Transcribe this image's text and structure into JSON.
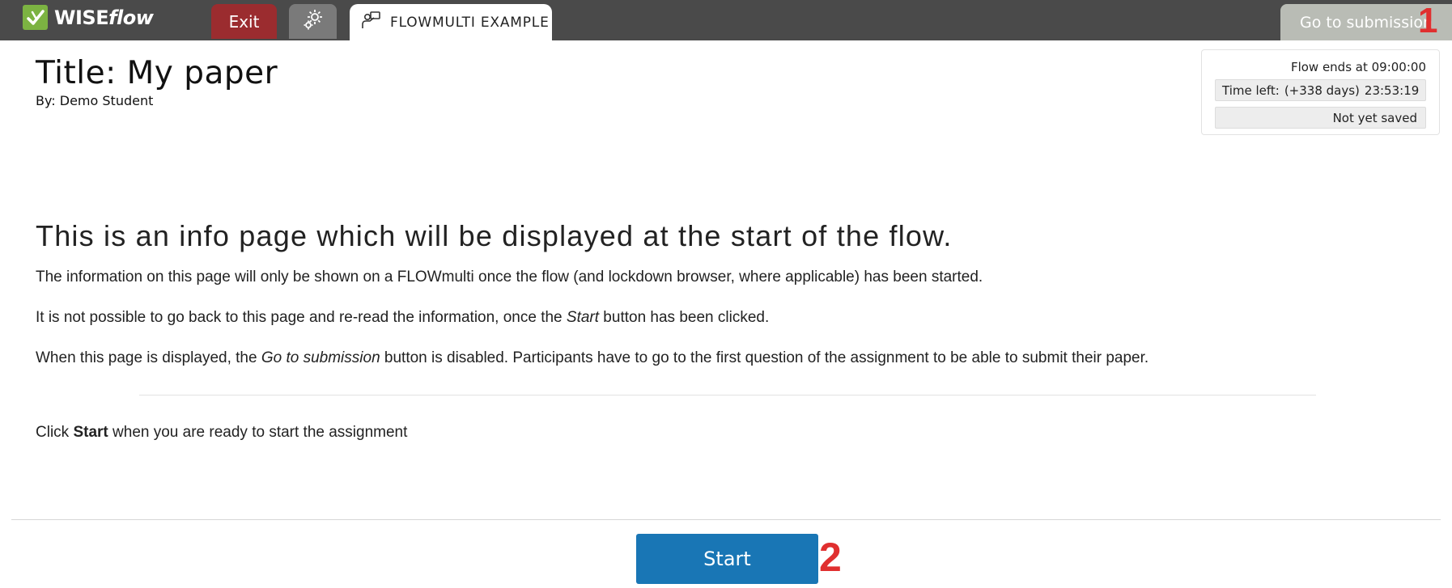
{
  "topbar": {
    "logo_text": "WISEflow",
    "logo_part_bold": "WISE",
    "logo_part_italic": "flow",
    "exit_label": "Exit",
    "settings_icon": "gear-icon",
    "tab_label": "FLOWMULTI EXAMPLE",
    "tab_icon": "presenter-icon",
    "submission_label": "Go to submission",
    "submission_marker": "1"
  },
  "header": {
    "title": "Title: My paper",
    "author": "By: Demo Student"
  },
  "status": {
    "flow_ends": "Flow ends at 09:00:00",
    "time_left_label": "Time left:",
    "time_left_days": "(+338 days)",
    "time_left_clock": "23:53:19",
    "save_state": "Not yet saved"
  },
  "info": {
    "heading": "This is an info page which will be displayed at the start of the flow.",
    "p1": "The information on this page will only be shown on a FLOWmulti once the flow (and lockdown browser, where applicable) has been started.",
    "p2_before": "It is not possible to go back to this page and re-read the information, once the ",
    "p2_em": "Start",
    "p2_after": " button has been clicked.",
    "p3_before": "When this page is displayed, the ",
    "p3_em": "Go to submission",
    "p3_after": " button is disabled. Participants have to go to the first question of the assignment to be able to submit their paper.",
    "p4_before": "Click ",
    "p4_strong": "Start",
    "p4_after": " when you are ready to start the assignment"
  },
  "footer": {
    "start_label": "Start",
    "start_marker": "2"
  },
  "colors": {
    "topbar": "#4a4a4a",
    "exit": "#9b2c2f",
    "settings": "#7a7a7a",
    "submission_disabled": "#b9bcb5",
    "start": "#1976b5",
    "marker": "#e02f2f",
    "logo": "#7cb342"
  }
}
